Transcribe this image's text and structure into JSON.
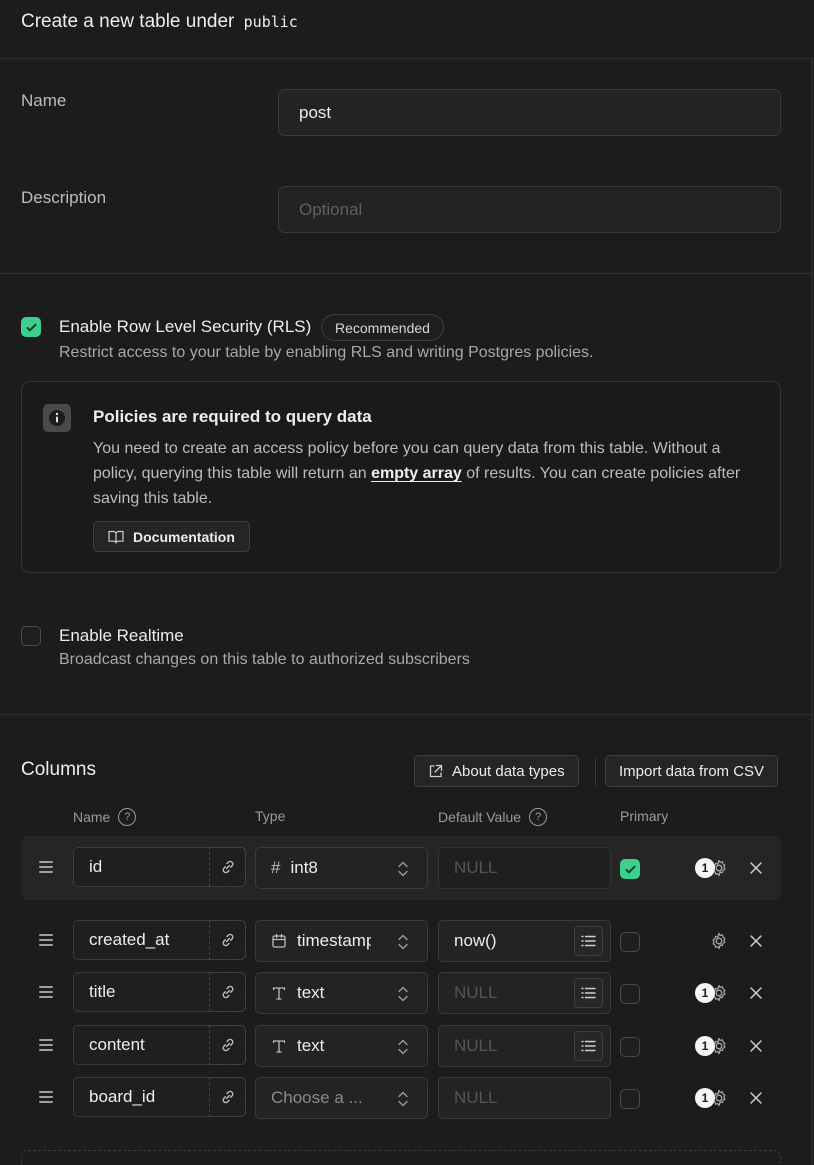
{
  "header": {
    "title": "Create a new table under",
    "schema": "public"
  },
  "form": {
    "name_label": "Name",
    "name_value": "post",
    "description_label": "Description",
    "description_placeholder": "Optional"
  },
  "rls": {
    "checked": true,
    "title": "Enable Row Level Security (RLS)",
    "badge": "Recommended",
    "description": "Restrict access to your table by enabling RLS and writing Postgres policies."
  },
  "callout": {
    "title": "Policies are required to query data",
    "text_before": "You need to create an access policy before you can query data from this table. Without a policy, querying this table will return an ",
    "link": "empty array",
    "text_after": " of results. You can create policies after saving this table.",
    "button": "Documentation"
  },
  "realtime": {
    "checked": false,
    "title": "Enable Realtime",
    "description": "Broadcast changes on this table to authorized subscribers"
  },
  "columns": {
    "title": "Columns",
    "about_button": "About data types",
    "import_button": "Import data from CSV",
    "headers": {
      "name": "Name",
      "type": "Type",
      "default": "Default Value",
      "primary": "Primary"
    },
    "rows": [
      {
        "name": "id",
        "type_icon": "hash-icon",
        "type": "int8",
        "default": "",
        "default_placeholder": "NULL",
        "primary": true,
        "badge": "1"
      },
      {
        "name": "created_at",
        "type_icon": "calendar-icon",
        "type": "timestamptz",
        "default": "now()",
        "default_placeholder": "NULL",
        "primary": false,
        "badge": ""
      },
      {
        "name": "title",
        "type_icon": "text-type-icon",
        "type": "text",
        "default": "",
        "default_placeholder": "NULL",
        "primary": false,
        "badge": "1"
      },
      {
        "name": "content",
        "type_icon": "text-type-icon",
        "type": "text",
        "default": "",
        "default_placeholder": "NULL",
        "primary": false,
        "badge": "1"
      },
      {
        "name": "board_id",
        "type_icon": "",
        "type": "",
        "type_placeholder": "Choose a ...",
        "default": "",
        "default_placeholder": "NULL",
        "primary": false,
        "badge": "1"
      }
    ]
  },
  "colors": {
    "accent": "#3ecf8e",
    "background": "#1c1c1c"
  }
}
